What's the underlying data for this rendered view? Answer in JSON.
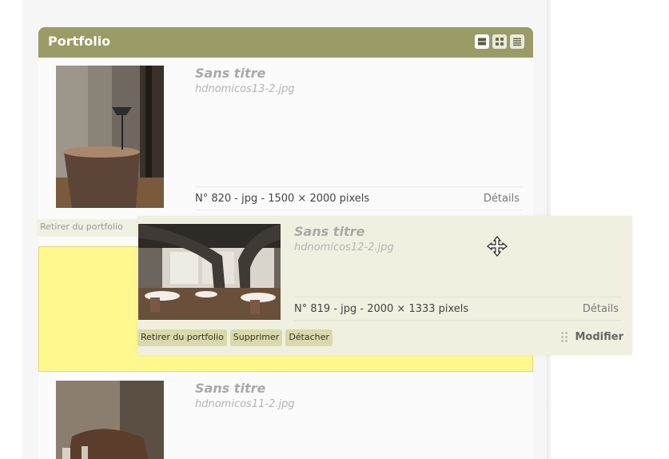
{
  "panel": {
    "title": "Portfolio"
  },
  "items": [
    {
      "title": "Sans titre",
      "filename": "hdnomicos13-2.jpg",
      "info": "N° 820 - jpg - 1500 × 2000 pixels",
      "details_label": "Détails"
    },
    {
      "title": "Sans titre",
      "filename": "hdnomicos12-2.jpg",
      "info": "N° 819 - jpg - 2000 × 1333 pixels",
      "details_label": "Détails"
    },
    {
      "title": "Sans titre",
      "filename": "hdnomicos11-2.jpg"
    }
  ],
  "actions": {
    "remove_label": "Retirer du portfolio",
    "remove_label_clipped": "Retirer du portfolio",
    "delete_label": "Supprimer",
    "detach_label": "Détacher",
    "modify_label": "Modifier"
  },
  "colors": {
    "header": "#9b9b67",
    "placeholder": "#fff88e",
    "action_button": "#d9d9ab"
  },
  "icons": [
    "list-view-icon",
    "grid-view-icon",
    "compact-list-icon",
    "move-cursor-icon",
    "drag-handle-icon"
  ]
}
